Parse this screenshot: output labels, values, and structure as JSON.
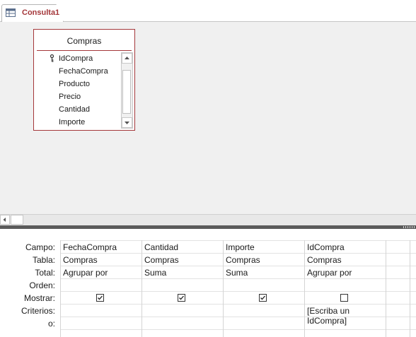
{
  "tab": {
    "title": "Consulta1",
    "icon": "query-design-icon"
  },
  "table": {
    "name": "Compras",
    "fields": [
      "IdCompra",
      "FechaCompra",
      "Producto",
      "Precio",
      "Cantidad",
      "Importe"
    ],
    "primary_key": "IdCompra"
  },
  "grid": {
    "row_labels": [
      "Campo:",
      "Tabla:",
      "Total:",
      "Orden:",
      "Mostrar:",
      "Criterios:",
      "o:"
    ],
    "columns": [
      {
        "campo": "FechaCompra",
        "tabla": "Compras",
        "total": "Agrupar por",
        "orden": "",
        "mostrar": true,
        "criterios": "",
        "o": ""
      },
      {
        "campo": "Cantidad",
        "tabla": "Compras",
        "total": "Suma",
        "orden": "",
        "mostrar": true,
        "criterios": "",
        "o": ""
      },
      {
        "campo": "Importe",
        "tabla": "Compras",
        "total": "Suma",
        "orden": "",
        "mostrar": true,
        "criterios": "",
        "o": ""
      },
      {
        "campo": "IdCompra",
        "tabla": "Compras",
        "total": "Agrupar por",
        "orden": "",
        "mostrar": false,
        "criterios": "[Escriba un IdCompra]",
        "o": ""
      }
    ]
  },
  "colors": {
    "accent": "#a4373a",
    "upper_bg": "#f0f0f0",
    "splitter": "#5b5b5b"
  }
}
